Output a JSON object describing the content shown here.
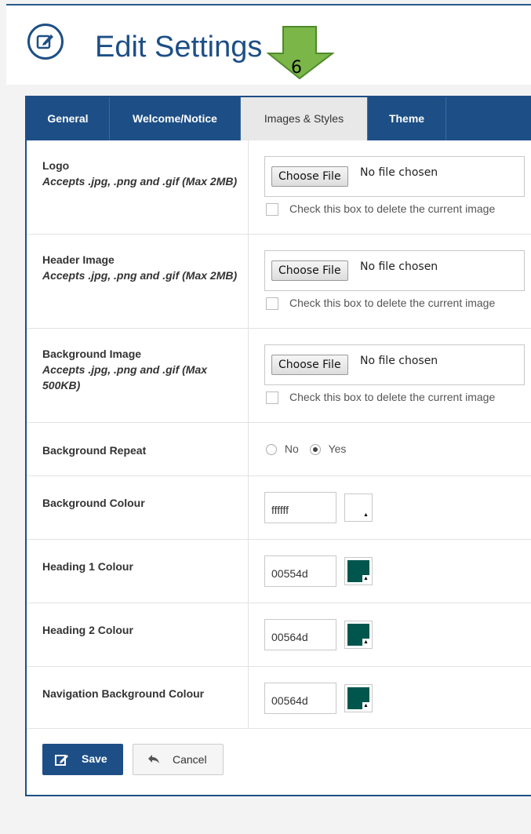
{
  "header": {
    "title": "Edit Settings",
    "annotation_number": "6"
  },
  "tabs": [
    {
      "label": "General"
    },
    {
      "label": "Welcome/Notice"
    },
    {
      "label": "Images & Styles",
      "active": true
    },
    {
      "label": "Theme"
    }
  ],
  "file_rows": [
    {
      "label": "Logo",
      "hint": "Accepts .jpg, .png and .gif (Max 2MB)",
      "button": "Choose File",
      "status": "No file chosen",
      "checkbox_label": "Check this box to delete the current image"
    },
    {
      "label": "Header Image",
      "hint": "Accepts .jpg, .png and .gif (Max 2MB)",
      "button": "Choose File",
      "status": "No file chosen",
      "checkbox_label": "Check this box to delete the current image"
    },
    {
      "label": "Background Image",
      "hint": "Accepts .jpg, .png and .gif (Max 500KB)",
      "button": "Choose File",
      "status": "No file chosen",
      "checkbox_label": "Check this box to delete the current image"
    }
  ],
  "background_repeat": {
    "label": "Background Repeat",
    "option_no": "No",
    "option_yes": "Yes",
    "selected": "Yes"
  },
  "color_rows": [
    {
      "label": "Background Colour",
      "value": "ffffff",
      "swatch": "#ffffff"
    },
    {
      "label": "Heading 1 Colour",
      "value": "00554d",
      "swatch": "#00554d"
    },
    {
      "label": "Heading 2 Colour",
      "value": "00564d",
      "swatch": "#00564d"
    },
    {
      "label": "Navigation Background Colour",
      "value": "00564d",
      "swatch": "#00564d"
    }
  ],
  "actions": {
    "save_label": "Save",
    "cancel_label": "Cancel"
  },
  "colors": {
    "primary": "#1d4f86",
    "arrow": "#7ab648"
  }
}
